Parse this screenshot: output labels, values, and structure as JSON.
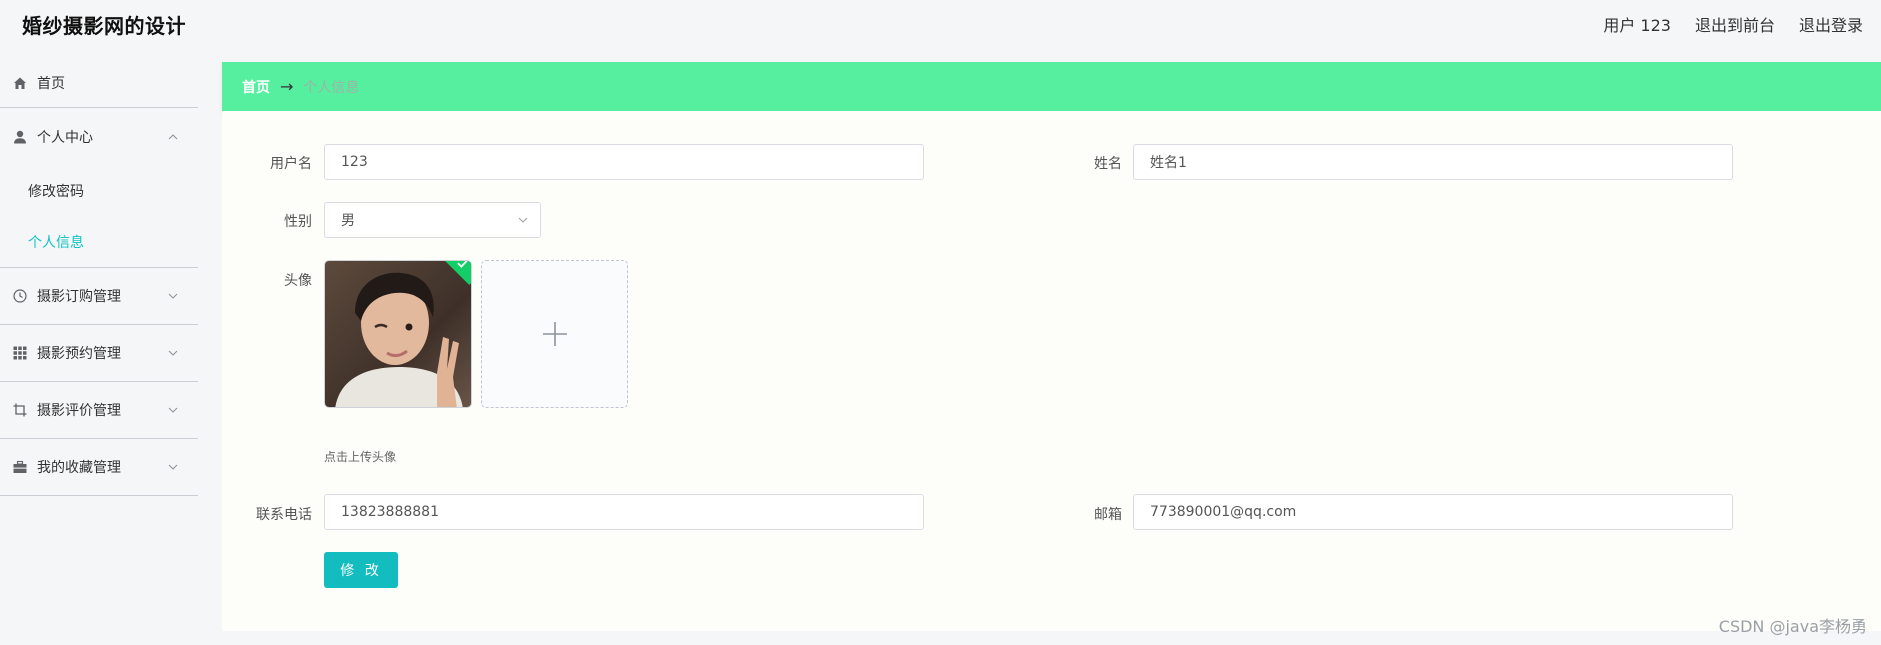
{
  "header": {
    "title": "婚纱摄影网的设计",
    "user": "用户 123",
    "to_front": "退出到前台",
    "logout": "退出登录"
  },
  "sidebar": {
    "home": "首页",
    "personal_center": "个人中心",
    "change_password": "修改密码",
    "personal_info": "个人信息",
    "order_mgmt": "摄影订购管理",
    "booking_mgmt": "摄影预约管理",
    "review_mgmt": "摄影评价管理",
    "favorites_mgmt": "我的收藏管理"
  },
  "breadcrumb": {
    "home": "首页",
    "arrow": "→",
    "current": "个人信息"
  },
  "form": {
    "username_label": "用户名",
    "username_value": "123",
    "name_label": "姓名",
    "name_value": "姓名1",
    "gender_label": "性别",
    "gender_value": "男",
    "avatar_label": "头像",
    "avatar_hint": "点击上传头像",
    "phone_label": "联系电话",
    "phone_value": "13823888881",
    "email_label": "邮箱",
    "email_value": "773890001@qq.com",
    "submit_label": "修 改"
  },
  "watermark": "CSDN @java李杨勇",
  "colors": {
    "accent": "#13bcbf",
    "breadcrumb_bg": "#56ef9f",
    "active_menu": "#13c2c2",
    "success_check": "#13ce66"
  }
}
